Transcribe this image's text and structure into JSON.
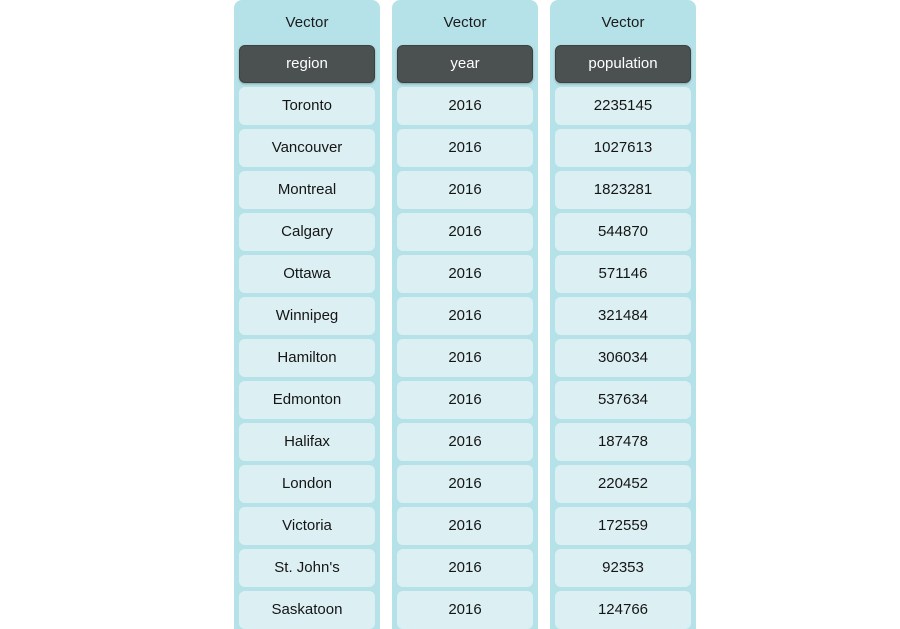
{
  "page": {
    "background_color": "#ffffff",
    "column_background_color": "#b5e2e8",
    "header_cell_color": "#4b5050",
    "data_cell_color": "#dcf0f4",
    "text_color": "#151515",
    "header_text_color": "#ffffff"
  },
  "columns": [
    {
      "title": "Vector",
      "header": "region",
      "values": [
        "Toronto",
        "Vancouver",
        "Montreal",
        "Calgary",
        "Ottawa",
        "Winnipeg",
        "Hamilton",
        "Edmonton",
        "Halifax",
        "London",
        "Victoria",
        "St. John's",
        "Saskatoon"
      ]
    },
    {
      "title": "Vector",
      "header": "year",
      "values": [
        "2016",
        "2016",
        "2016",
        "2016",
        "2016",
        "2016",
        "2016",
        "2016",
        "2016",
        "2016",
        "2016",
        "2016",
        "2016"
      ]
    },
    {
      "title": "Vector",
      "header": "population",
      "values": [
        "2235145",
        "1027613",
        "1823281",
        "544870",
        "571146",
        "321484",
        "306034",
        "537634",
        "187478",
        "220452",
        "172559",
        "92353",
        "124766"
      ]
    }
  ]
}
